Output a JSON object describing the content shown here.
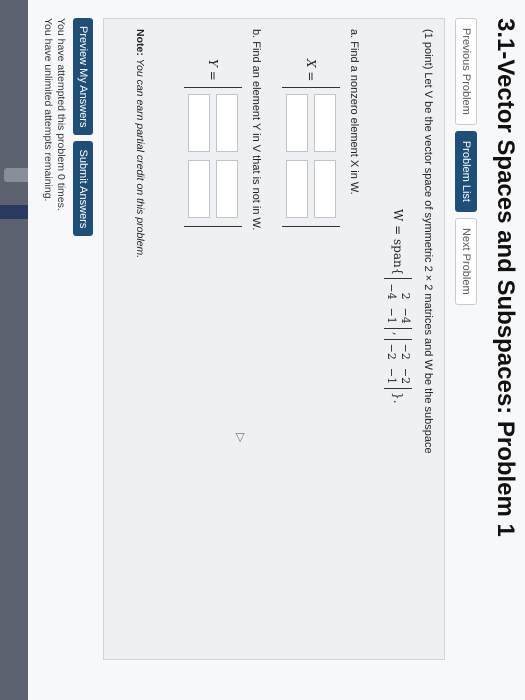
{
  "page": {
    "title": "3.1-Vector Spaces and Subspaces: Problem 1"
  },
  "nav": {
    "previous": "Previous Problem",
    "list": "Problem List",
    "next": "Next Problem"
  },
  "problem": {
    "statement": "(1 point) Let V be the vector space of symmetric 2 × 2 matrices and W be the subspace",
    "w_label": "W = span{",
    "w_sep": ",",
    "w_close": "}.",
    "matrix1": [
      "2",
      "−4",
      "−4",
      "−1"
    ],
    "matrix2": [
      "−2",
      "−2",
      "−2",
      "−1"
    ],
    "part_a": "a. Find a nonzero element X in W.",
    "var_x": "X =",
    "part_b": "b. Find an element Y in V that is not in W.",
    "var_y": "Y =",
    "note_bold": "Note:",
    "note_text": " You can earn partial credit on this problem."
  },
  "actions": {
    "preview": "Preview My Answers",
    "submit": "Submit Answers"
  },
  "status": {
    "attempts": "You have attempted this problem 0 times.",
    "remaining": "You have unlimited attempts remaining."
  },
  "colors": {
    "primary_button": "#1f4e79",
    "panel_background": "#eef0f3"
  }
}
